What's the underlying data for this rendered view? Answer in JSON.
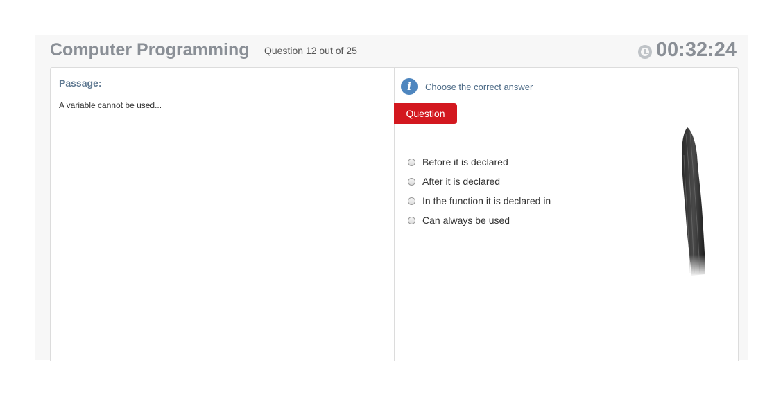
{
  "header": {
    "title": "Computer Programming",
    "question_count": "Question 12 out of 25",
    "timer": "00:32:24"
  },
  "passage": {
    "label": "Passage:",
    "text": "A variable cannot be used..."
  },
  "question_panel": {
    "instruction": "Choose the correct answer",
    "tab_label": "Question",
    "options": [
      "Before it is declared",
      "After it is declared",
      "In the function it is declared in",
      "Can always be used"
    ]
  },
  "icons": {
    "clock": "clock-icon",
    "info": "info-icon",
    "radio": "radio-button"
  }
}
